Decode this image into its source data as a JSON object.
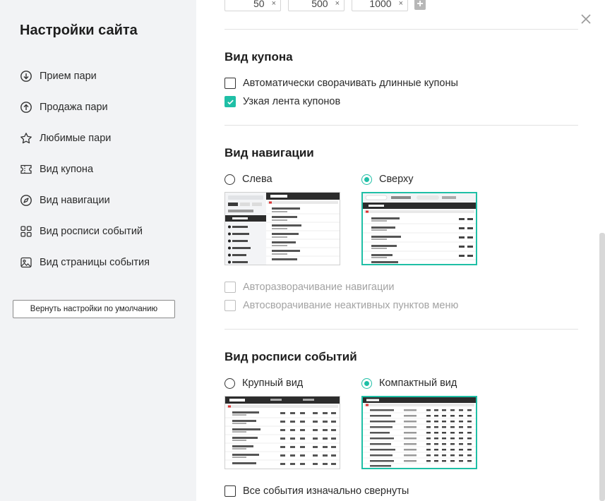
{
  "sidebar": {
    "title": "Настройки сайта",
    "items": [
      {
        "label": "Прием пари",
        "icon": "download-circle-icon"
      },
      {
        "label": "Продажа пари",
        "icon": "upload-circle-icon"
      },
      {
        "label": "Любимые пари",
        "icon": "star-icon"
      },
      {
        "label": "Вид купона",
        "icon": "ticket-icon"
      },
      {
        "label": "Вид навигации",
        "icon": "compass-icon"
      },
      {
        "label": "Вид росписи событий",
        "icon": "grid-icon"
      },
      {
        "label": "Вид страницы события",
        "icon": "image-icon"
      }
    ],
    "reset_label": "Вернуть настройки по умолчанию"
  },
  "amounts": {
    "chips": [
      {
        "value": "50",
        "remove": "×"
      },
      {
        "value": "500",
        "remove": "×"
      },
      {
        "value": "1000",
        "remove": "×"
      }
    ],
    "add_label": "+"
  },
  "coupon_view": {
    "title": "Вид купона",
    "options": [
      {
        "label": "Автоматически сворачивать длинные купоны",
        "checked": false
      },
      {
        "label": "Узкая лента купонов",
        "checked": true
      }
    ]
  },
  "navigation_view": {
    "title": "Вид навигации",
    "radios": [
      {
        "label": "Слева",
        "selected": false
      },
      {
        "label": "Сверху",
        "selected": true
      }
    ],
    "options": [
      {
        "label": "Авторазворачивание навигации",
        "checked": false,
        "disabled": true
      },
      {
        "label": "Автосворачивание неактивных пунктов меню",
        "checked": false,
        "disabled": true
      }
    ]
  },
  "events_view": {
    "title": "Вид росписи событий",
    "radios": [
      {
        "label": "Крупный вид",
        "selected": false
      },
      {
        "label": "Компактный вид",
        "selected": true
      }
    ],
    "options": [
      {
        "label": "Все события изначально свернуты",
        "checked": false
      }
    ]
  },
  "colors": {
    "accent": "#1fbfa6",
    "sidebar_bg": "#f2f3f5"
  }
}
